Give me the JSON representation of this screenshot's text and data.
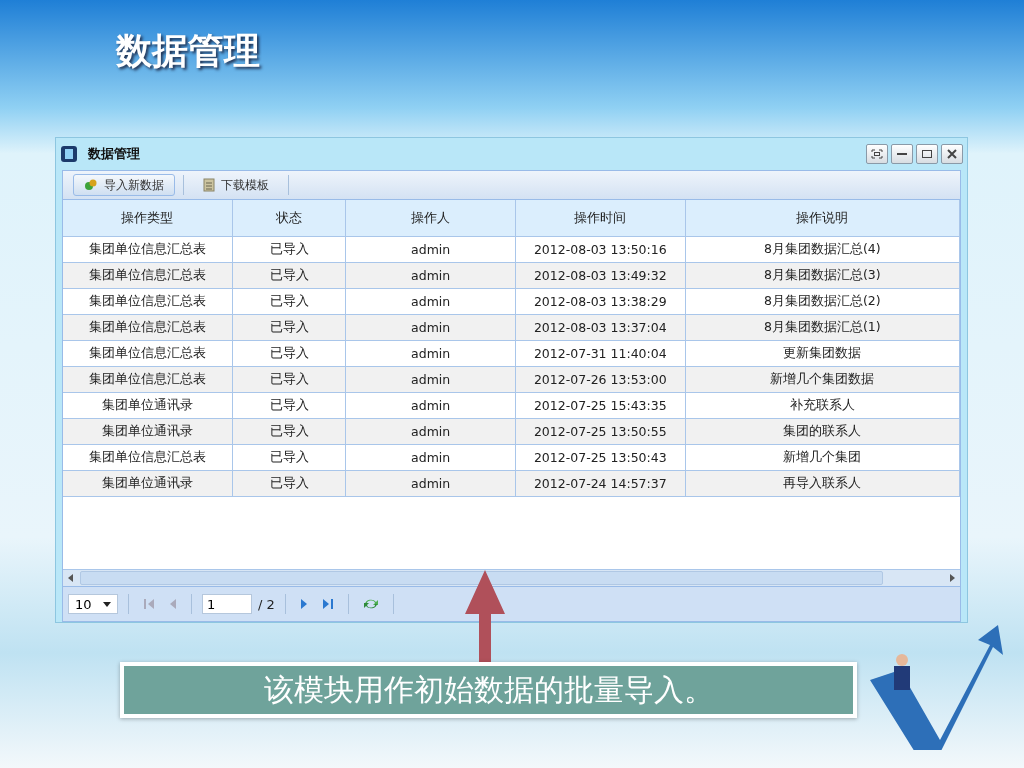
{
  "slide_title": "数据管理",
  "window": {
    "title": "数据管理"
  },
  "toolbar": {
    "buttons": [
      {
        "label": "导入新数据",
        "kind": "import",
        "selected": true
      },
      {
        "label": "下载模板",
        "kind": "download",
        "selected": false
      }
    ]
  },
  "table": {
    "columns": [
      "操作类型",
      "状态",
      "操作人",
      "操作时间",
      "操作说明"
    ],
    "rows": [
      [
        "集团单位信息汇总表",
        "已导入",
        "admin",
        "2012-08-03 13:50:16",
        "8月集团数据汇总(4)"
      ],
      [
        "集团单位信息汇总表",
        "已导入",
        "admin",
        "2012-08-03 13:49:32",
        "8月集团数据汇总(3)"
      ],
      [
        "集团单位信息汇总表",
        "已导入",
        "admin",
        "2012-08-03 13:38:29",
        "8月集团数据汇总(2)"
      ],
      [
        "集团单位信息汇总表",
        "已导入",
        "admin",
        "2012-08-03 13:37:04",
        "8月集团数据汇总(1)"
      ],
      [
        "集团单位信息汇总表",
        "已导入",
        "admin",
        "2012-07-31 11:40:04",
        "更新集团数据"
      ],
      [
        "集团单位信息汇总表",
        "已导入",
        "admin",
        "2012-07-26 13:53:00",
        "新增几个集团数据"
      ],
      [
        "集团单位通讯录",
        "已导入",
        "admin",
        "2012-07-25 15:43:35",
        "补充联系人"
      ],
      [
        "集团单位通讯录",
        "已导入",
        "admin",
        "2012-07-25 13:50:55",
        "集团的联系人"
      ],
      [
        "集团单位信息汇总表",
        "已导入",
        "admin",
        "2012-07-25 13:50:43",
        "新增几个集团"
      ],
      [
        "集团单位通讯录",
        "已导入",
        "admin",
        "2012-07-24 14:57:37",
        "再导入联系人"
      ]
    ]
  },
  "pager": {
    "page_size": "10",
    "page": "1",
    "total_pages": "/ 2"
  },
  "caption": "该模块用作初始数据的批量导入。"
}
